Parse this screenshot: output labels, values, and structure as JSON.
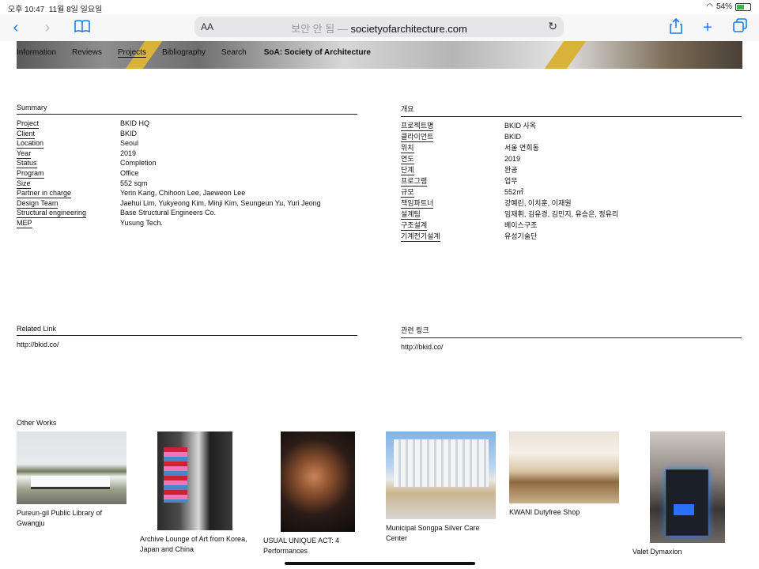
{
  "status": {
    "time": "오후 10:47",
    "date": "11월 8일 일요일",
    "battery": "54%",
    "battery_level": 0.54
  },
  "browser": {
    "aa": "AA",
    "security": "보안 안 됨",
    "separator": "—",
    "url": "societyofarchitecture.com",
    "icons": [
      "back-icon",
      "forward-icon",
      "book-icon",
      "share-icon",
      "plus-icon",
      "tabs-icon",
      "reload-icon"
    ]
  },
  "nav": {
    "items": [
      "Information",
      "Reviews",
      "Projects",
      "Bibliography",
      "Search"
    ],
    "brand": "SoA: Society of Architecture",
    "active": "Projects"
  },
  "summary_en": {
    "title": "Summary",
    "rows": [
      {
        "k": "Project",
        "v": "BKID HQ"
      },
      {
        "k": "Client",
        "v": "BKID"
      },
      {
        "k": "Location",
        "v": "Seoul"
      },
      {
        "k": "Year",
        "v": "2019"
      },
      {
        "k": "Status",
        "v": "Completion"
      },
      {
        "k": "Program",
        "v": "Office"
      },
      {
        "k": "Size",
        "v": "552 sqm"
      },
      {
        "k": "Partner in charge",
        "v": "Yerin Kang, Chihoon Lee, Jaeweon Lee"
      },
      {
        "k": "Design Team",
        "v": "Jaehui Lim, Yukyeong Kim, Minji Kim, Seungeun Yu, Yuri Jeong"
      },
      {
        "k": "Structural engineering",
        "v": "Base Structural Engineers Co."
      },
      {
        "k": "MEP",
        "v": "Yusung Tech."
      }
    ]
  },
  "summary_ko": {
    "title": "개요",
    "rows": [
      {
        "k": "프로젝트명",
        "v": "BKID 사옥"
      },
      {
        "k": "클라이언트",
        "v": "BKID"
      },
      {
        "k": "위치",
        "v": "서울 연희동"
      },
      {
        "k": "연도",
        "v": "2019"
      },
      {
        "k": "단계",
        "v": "완공"
      },
      {
        "k": "프로그램",
        "v": "업무"
      },
      {
        "k": "규모",
        "v": "552㎡"
      },
      {
        "k": "책임파트너",
        "v": "강예린, 이치훈, 이재원"
      },
      {
        "k": "설계팀",
        "v": "임재휘, 김유경, 김민지, 유승은, 정유리"
      },
      {
        "k": "구조설계",
        "v": "베이스구조"
      },
      {
        "k": "기계전기설계",
        "v": "유성기술단"
      }
    ]
  },
  "related_en": {
    "title": "Related Link",
    "url": "http://bkid.co/"
  },
  "related_ko": {
    "title": "관련 링크",
    "url": "http://bkid.co/"
  },
  "other": {
    "title": "Other Works",
    "items": [
      {
        "line1": "Pureun-gil Public Library of",
        "line2": "Gwangju"
      },
      {
        "line1": "Archive Lounge of Art from Korea,",
        "line2": "Japan and China"
      },
      {
        "line1": "USUAL UNIQUE ACT: 4",
        "line2": "Performances"
      },
      {
        "line1": "Municipal Songpa Silver Care",
        "line2": "Center"
      },
      {
        "line1": "KWANI Dutyfree Shop",
        "line2": ""
      },
      {
        "line1": "Valet Dymaxion",
        "line2": ""
      }
    ]
  }
}
